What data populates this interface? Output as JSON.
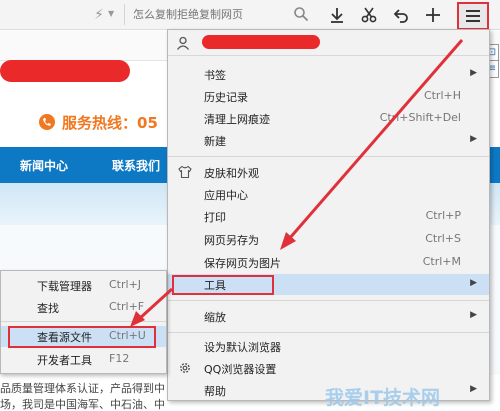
{
  "toolbar": {
    "search_placeholder": "怎么复制拒绝复制网页",
    "icons": [
      "bolt-icon",
      "search-icon",
      "download-icon",
      "scissors-icon",
      "undo-icon",
      "plus-icon",
      "menu-icon"
    ]
  },
  "page": {
    "hotline": "服务热线：05",
    "nav": [
      "新闻中心",
      "联系我们"
    ],
    "text_line_1": "品质量管理体系认证，产品得到中",
    "text_line_2": "场，我司是中国海军、中石油、中"
  },
  "main_menu": {
    "items": [
      {
        "label": "书签",
        "shortcut": "",
        "submenu": true
      },
      {
        "label": "历史记录",
        "shortcut": "Ctrl+H",
        "submenu": false
      },
      {
        "label": "清理上网痕迹",
        "shortcut": "Ctrl+Shift+Del",
        "submenu": false
      },
      {
        "label": "新建",
        "shortcut": "",
        "submenu": true
      },
      {
        "label": "皮肤和外观",
        "shortcut": "",
        "submenu": false
      },
      {
        "label": "应用中心",
        "shortcut": "",
        "submenu": false
      },
      {
        "label": "打印",
        "shortcut": "Ctrl+P",
        "submenu": false
      },
      {
        "label": "网页另存为",
        "shortcut": "Ctrl+S",
        "submenu": false
      },
      {
        "label": "保存网页为图片",
        "shortcut": "Ctrl+M",
        "submenu": false
      },
      {
        "label": "工具",
        "shortcut": "",
        "submenu": true
      },
      {
        "label": "缩放",
        "shortcut": "",
        "submenu": true
      },
      {
        "label": "设为默认浏览器",
        "shortcut": "",
        "submenu": false
      },
      {
        "label": "QQ浏览器设置",
        "shortcut": "",
        "submenu": false
      },
      {
        "label": "帮助",
        "shortcut": "",
        "submenu": true
      }
    ]
  },
  "sub_menu": {
    "items": [
      {
        "label": "下载管理器",
        "shortcut": "Ctrl+J"
      },
      {
        "label": "查找",
        "shortcut": "Ctrl+F"
      },
      {
        "label": "查看源文件",
        "shortcut": "Ctrl+U"
      },
      {
        "label": "开发者工具",
        "shortcut": "F12"
      }
    ]
  },
  "colors": {
    "accent_red": "#e0313a",
    "highlight": "#cce0f5",
    "site_nav": "#0d79c4",
    "hotline": "#f07820"
  },
  "watermark": "我爱IT技术网"
}
